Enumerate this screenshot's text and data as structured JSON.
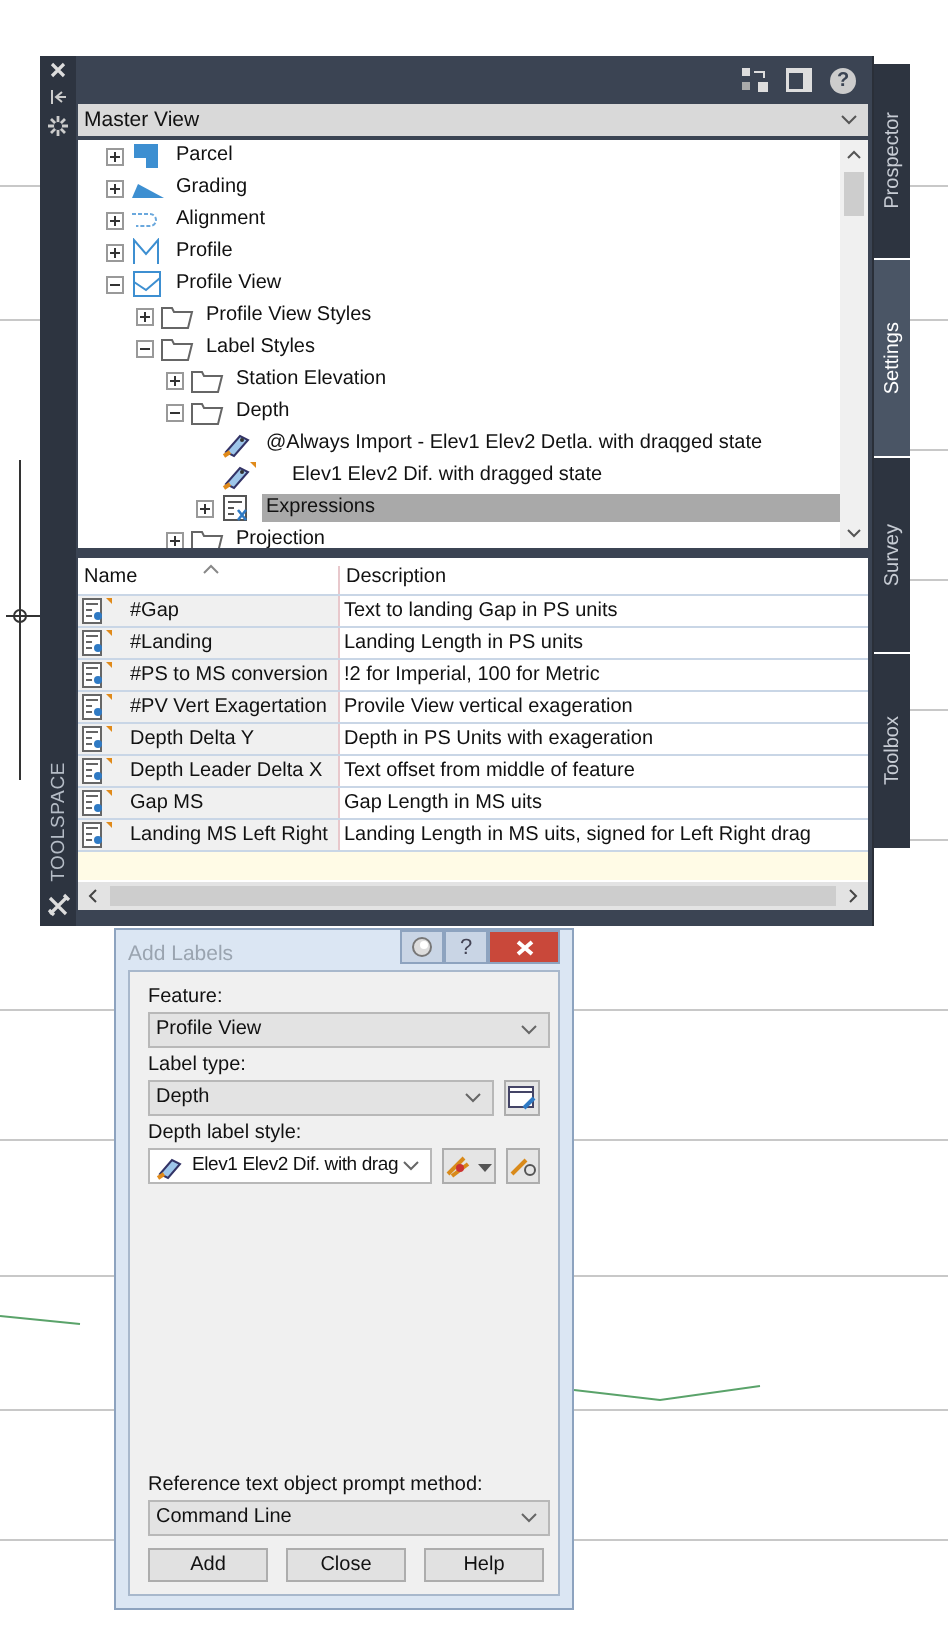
{
  "toolspace": {
    "title": "TOOLSPACE",
    "help_glyph": "?",
    "view_selector": {
      "value": "Master View"
    },
    "tree": {
      "items": [
        {
          "label": "Parcel",
          "kind": "parcel",
          "expanded": false
        },
        {
          "label": "Grading",
          "kind": "grading",
          "expanded": false
        },
        {
          "label": "Alignment",
          "kind": "alignment",
          "expanded": false
        },
        {
          "label": "Profile",
          "kind": "profile",
          "expanded": false
        },
        {
          "label": "Profile View",
          "kind": "profile-view",
          "expanded": true,
          "children": [
            {
              "label": "Profile View Styles",
              "kind": "folder",
              "expanded": false
            },
            {
              "label": "Label Styles",
              "kind": "folder",
              "expanded": true,
              "children": [
                {
                  "label": "Station Elevation",
                  "kind": "folder",
                  "expanded": false
                },
                {
                  "label": "Depth",
                  "kind": "folder",
                  "expanded": true,
                  "children": [
                    {
                      "label": "@Always Import - Elev1  Elev2  Detla. with draqged state",
                      "kind": "label-style",
                      "flagged": false,
                      "selected": false
                    },
                    {
                      "label": "Elev1 Elev2  Dif. with dragged state",
                      "kind": "label-style",
                      "flagged": true,
                      "selected": false
                    },
                    {
                      "label": "Expressions",
                      "kind": "expressions",
                      "expanded": false,
                      "selected": true
                    }
                  ]
                },
                {
                  "label": "Projection",
                  "kind": "folder",
                  "expanded": false
                }
              ]
            }
          ]
        }
      ]
    },
    "table": {
      "columns": [
        "Name",
        "Description"
      ],
      "rows": [
        {
          "name": "#Gap",
          "description": "Text to landing Gap in PS units"
        },
        {
          "name": "#Landing",
          "description": "Landing Length in PS units"
        },
        {
          "name": "#PS to MS conversion",
          "description": "!2 for Imperial, 100 for Metric"
        },
        {
          "name": "#PV Vert Exagertation",
          "description": "Provile View vertical exageration"
        },
        {
          "name": "Depth Delta Y",
          "description": "Depth in PS Units with exageration"
        },
        {
          "name": "Depth Leader Delta X",
          "description": "Text offset from middle of feature"
        },
        {
          "name": "Gap MS",
          "description": "Gap Length in MS uits"
        },
        {
          "name": "Landing MS Left Right",
          "description": "Landing Length in MS uits, signed for Left Right drag"
        }
      ]
    },
    "side_tabs": [
      {
        "label": "Prospector",
        "selected": false
      },
      {
        "label": "Settings",
        "selected": true
      },
      {
        "label": "Survey",
        "selected": false
      },
      {
        "label": "Toolbox",
        "selected": false
      }
    ]
  },
  "dialog": {
    "title": "Add Labels",
    "help_glyph": "?",
    "feature": {
      "label": "Feature:",
      "value": "Profile View"
    },
    "label_type": {
      "label": "Label type:",
      "value": "Depth"
    },
    "label_style": {
      "label": "Depth label style:",
      "value": "Elev1 Elev2  Dif. with drag"
    },
    "prompt_method": {
      "label": "Reference text object prompt method:",
      "value": "Command Line"
    },
    "buttons": [
      "Add",
      "Close",
      "Help"
    ]
  }
}
